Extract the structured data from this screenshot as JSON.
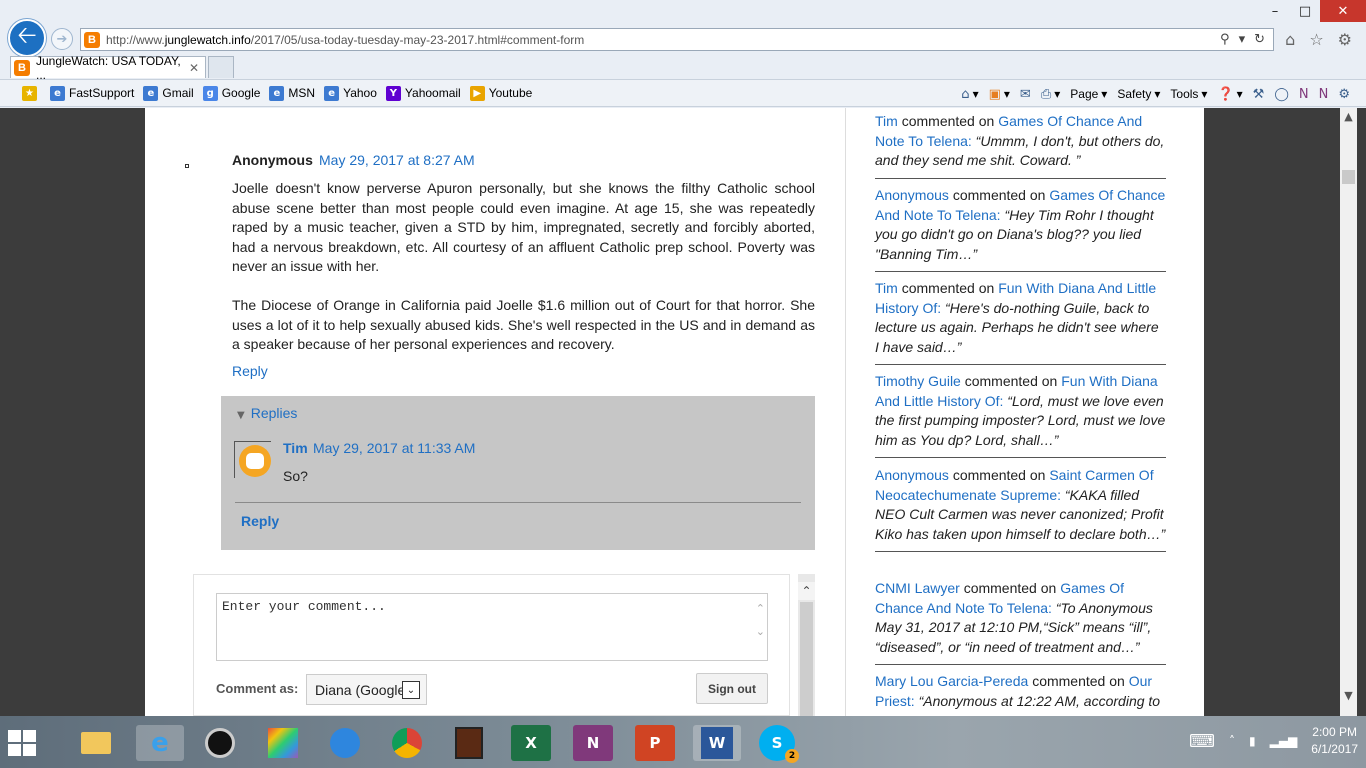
{
  "browser": {
    "url_prefix": "http://www.",
    "url_domain": "junglewatch.info",
    "url_suffix": "/2017/05/usa-today-tuesday-may-23-2017.html#comment-form",
    "tab_title": "JungleWatch: USA TODAY, ...",
    "favorites": [
      {
        "label": "FastSupport",
        "icon": "ie-page-icon"
      },
      {
        "label": "Gmail",
        "icon": "ie-page-icon"
      },
      {
        "label": "Google",
        "icon": "google-icon"
      },
      {
        "label": "MSN",
        "icon": "ie-page-icon"
      },
      {
        "label": "Yahoo",
        "icon": "ie-page-icon"
      },
      {
        "label": "Yahoomail",
        "icon": "yahoo-icon"
      },
      {
        "label": "Youtube",
        "icon": "youtube-icon"
      }
    ],
    "commands": {
      "page": "Page",
      "safety": "Safety",
      "tools": "Tools"
    }
  },
  "comment": {
    "author": "Anonymous",
    "date": "May 29, 2017 at 8:27 AM",
    "paragraph1": "Joelle doesn't know perverse Apuron personally, but she knows the filthy Catholic school abuse scene better than most people could even imagine. At age 15, she was repeatedly raped by a music teacher, given a STD by him, impregnated, secretly and forcibly aborted, had a nervous breakdown, etc. All courtesy of an affluent Catholic prep school. Poverty was never an issue with her.",
    "paragraph2": "The Diocese of Orange in California paid Joelle $1.6 million out of Court for that horror. She uses a lot of it to help sexually abused kids. She's well respected in the US and in demand as a speaker because of her personal experiences and recovery.",
    "reply_label": "Reply"
  },
  "replies": {
    "toggle_label": "Replies",
    "items": [
      {
        "author": "Tim",
        "date": "May 29, 2017 at 11:33 AM",
        "text": "So?"
      }
    ],
    "reply_label": "Reply"
  },
  "comment_form": {
    "placeholder": "Enter your comment...",
    "comment_as_label": "Comment as:",
    "identity": "Diana (Google",
    "signout_label": "Sign out"
  },
  "recent_comments": [
    {
      "user": "Tim",
      "verb": "commented on",
      "post": "Games Of Chance And Note To Telena:",
      "quote": "“Ummm, I don't, but others do, and they send me shit. Coward. ”"
    },
    {
      "user": "Anonymous",
      "verb": "commented on",
      "post": "Games Of Chance And Note To Telena:",
      "quote": "“Hey Tim Rohr I thought you go didn't go on Diana's blog?? you lied \"Banning Tim…”"
    },
    {
      "user": "Tim",
      "verb": "commented on",
      "post": "Fun With Diana And Little History Of:",
      "quote": "“Here's do-nothing Guile, back to lecture us again. Perhaps he didn't see where I have said…”"
    },
    {
      "user": "Timothy Guile",
      "verb": "commented on",
      "post": "Fun With Diana And Little History Of:",
      "quote": "“Lord, must we love even the first pumping imposter? Lord, must we love him as You dp? Lord, shall…”"
    },
    {
      "user": "Anonymous",
      "verb": "commented on",
      "post": "Saint Carmen Of Neocatechumenate Supreme:",
      "quote": "“KAKA filled NEO Cult Carmen was never canonized; Profit Kiko has taken upon himself to declare both…”"
    },
    {
      "user": "CNMI Lawyer",
      "verb": "commented on",
      "post": "Games Of Chance And Note To Telena:",
      "quote": "“To Anonymous May 31, 2017 at 12:10 PM,“Sick” means “ill”, “diseased”, or “in need of treatment and…”"
    },
    {
      "user": "Mary Lou Garcia-Pereda",
      "verb": "commented on",
      "post": "Our Priest:",
      "quote": "“Anonymous at 12:22 AM, according to"
    }
  ],
  "taskbar": {
    "time": "2:00 PM",
    "date": "6/1/2017",
    "apps": [
      "file-explorer-icon",
      "internet-explorer-icon",
      "camera-app-icon",
      "photo-app-icon",
      "network-app-icon",
      "chrome-icon",
      "media-app-icon",
      "excel-icon",
      "onenote-icon",
      "powerpoint-icon",
      "word-icon",
      "skype-icon"
    ],
    "skype_badge": "2"
  },
  "colors": {
    "link": "#1f6fc4",
    "replies_bg": "#c6c6c6",
    "close_button": "#c7362c"
  }
}
